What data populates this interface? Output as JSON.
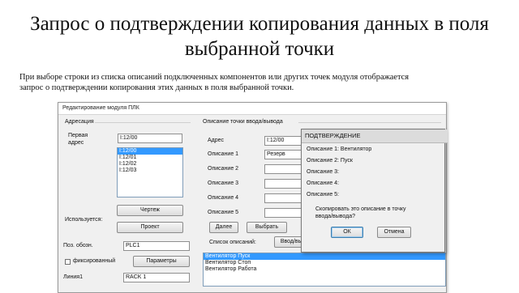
{
  "slide": {
    "title_line1": "Запрос о подтверждении копирования данных в поля",
    "title_line2": "выбранной точки",
    "description_line1": "При выборе строки из списка описаний подключенных компонентов или других точек модуля отображается",
    "description_line2": "запрос о подтверждении копирования этих данных в поля выбранной точки."
  },
  "window": {
    "title": "Редактирование модуля ПЛК",
    "addressing": {
      "group_label": "Адресация",
      "first_address_label_1": "Первая",
      "first_address_label_2": "адрес",
      "first_address_value": "I:12/00",
      "address_list": [
        "I:12/00",
        "I:12/01",
        "I:12/02",
        "I:12/03"
      ],
      "selected_index": 0,
      "drawing_button": "Чертеж",
      "used_label": "Используется:",
      "project_button": "Проект"
    },
    "pos_label": "Поз. обозн.",
    "pos_value": "PLC1",
    "fixed_label": "фиксированный",
    "fixed_checked": false,
    "params_button": "Параметры",
    "line_label": "Линия1",
    "line_value": "RACK 1",
    "io_point": {
      "group_label": "Описание точки ввода/вывода",
      "address_label": "Адрес",
      "address_value": "I:12/00",
      "desc1_label": "Описание 1",
      "desc1_value": "Резерв",
      "desc2_label": "Описание 2",
      "desc3_label": "Описание 3",
      "desc4_label": "Описание 4",
      "desc5_label": "Описание 5",
      "next_button": "Далее",
      "select_button": "Выбрать",
      "desc_list_label": "Список описаний:",
      "in_out_button": "Ввод/вывод",
      "desc_list": [
        "Вентилятор Пуск",
        "Вентилятор Стоп",
        "Вентилятор Работа"
      ],
      "desc_selected_index": 0
    }
  },
  "dialog": {
    "title": "ПОДТВЕРЖДЕНИЕ",
    "lines": [
      "Описание 1: Вентилятор",
      "Описание 2: Пуск",
      "Описание 3:",
      "Описание 4:",
      "Описание 5:"
    ],
    "question_line1": "Скопировать это описание в точку",
    "question_line2": "ввода/вывода?",
    "ok_button": "ОК",
    "cancel_button": "Отмена"
  },
  "colors": {
    "selection": "#3399ff",
    "ok_focus": "#3c7fb1"
  }
}
